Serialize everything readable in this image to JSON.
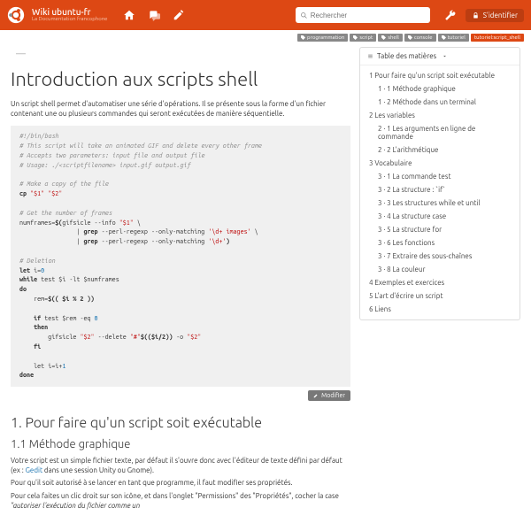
{
  "header": {
    "site_title": "Wiki ubuntu-fr",
    "site_subtitle": "La Documentation francophone",
    "search_placeholder": "Rechercher",
    "signin_label": "S'identifier"
  },
  "tags": {
    "list": [
      "programmation",
      "script",
      "shell",
      "console",
      "tutoriel"
    ],
    "current": "tutoriel:script_shell"
  },
  "article": {
    "dash": "—",
    "title": "Introduction aux scripts shell",
    "intro": "Un script shell permet d'automatiser une série d'opérations. Il se présente sous la forme d'un fichier contenant une ou plusieurs commandes qui seront exécutées de manière séquentielle.",
    "edit_label": "Modifier",
    "section1_title": "1. Pour faire qu'un script soit exécutable",
    "section1_1_title": "1.1 Méthode graphique",
    "p1": "Votre script est un simple fichier texte, par défaut il s'ouvre donc avec l'éditeur de texte défini par défaut (ex : ",
    "p1_link": "Gedit",
    "p1_tail": " dans une session Unity ou Gnome).",
    "p2": "Pour qu'il soit autorisé à se lancer en tant que programme, il faut modifier ses propriétés.",
    "p3_a": "Pour cela faites un clic droit sur son icône, et dans l'onglet \"Permissions\" des \"Propriétés\", cocher la case ",
    "p3_b": "\"autoriser l'exécution du fichier comme un"
  },
  "code": {
    "l1": "#!/bin/bash",
    "l2": "# This script will take an animated GIF and delete every other frame",
    "l3": "# Accepts two parameters: input file and output file",
    "l4": "# Usage: ./<scriptfilename> input.gif output.gif",
    "l5": "# Make a copy of the file",
    "cp": "cp",
    "s1": "\"$1\"",
    "s2": "\"$2\"",
    "l7": "# Get the number of frames",
    "nf": "numframes",
    "gi": "gifsicle --info ",
    "g1": "grep",
    "gp1": " --perl-regexp --only-matching ",
    "re1": "'\\d+ images'",
    "re2": "'\\d+'",
    "l10": "# Deletion",
    "let": "let",
    "i0": "i=",
    "zero": "0",
    "while": "while",
    "test": " test ",
    "dlt": "$i -lt $numframes",
    "do": "do",
    "rem": "    rem=",
    "mod": "$(( $i % 2 ))",
    "if": "    if",
    "eq0": "$rem -eq ",
    "then": "    then",
    "gif2": "        gifsicle ",
    "del": " --delete ",
    "hash": "\"#\"",
    "i2": "$(($i/2))",
    "o": " -o ",
    "fi": "    fi",
    "inc": "    let i=i+",
    "one": "1",
    "done": "done"
  },
  "toc": {
    "title": "Table des matières",
    "items": [
      {
        "label": "1  Pour faire qu'un script soit exécutable",
        "lvl": 1
      },
      {
        "label": "1 · 1  Méthode graphique",
        "lvl": 2
      },
      {
        "label": "1 · 2  Méthode dans un terminal",
        "lvl": 2
      },
      {
        "label": "2  Les variables",
        "lvl": 1
      },
      {
        "label": "2 · 1  Les arguments en ligne de commande",
        "lvl": 2
      },
      {
        "label": "2 · 2  L'arithmétique",
        "lvl": 2
      },
      {
        "label": "3  Vocabulaire",
        "lvl": 1
      },
      {
        "label": "3 · 1  La commande test",
        "lvl": 2
      },
      {
        "label": "3 · 2  La structure : `if`",
        "lvl": 2
      },
      {
        "label": "3 · 3  Les structures while et until",
        "lvl": 2
      },
      {
        "label": "3 · 4  La structure case",
        "lvl": 2
      },
      {
        "label": "3 · 5  La structure for",
        "lvl": 2
      },
      {
        "label": "3 · 6  Les fonctions",
        "lvl": 2
      },
      {
        "label": "3 · 7  Extraire des sous-chaînes",
        "lvl": 2
      },
      {
        "label": "3 · 8  La couleur",
        "lvl": 2
      },
      {
        "label": "4  Exemples et exercices",
        "lvl": 1
      },
      {
        "label": "5  L'art d'écrire un script",
        "lvl": 1
      },
      {
        "label": "6  Liens",
        "lvl": 1
      }
    ]
  }
}
